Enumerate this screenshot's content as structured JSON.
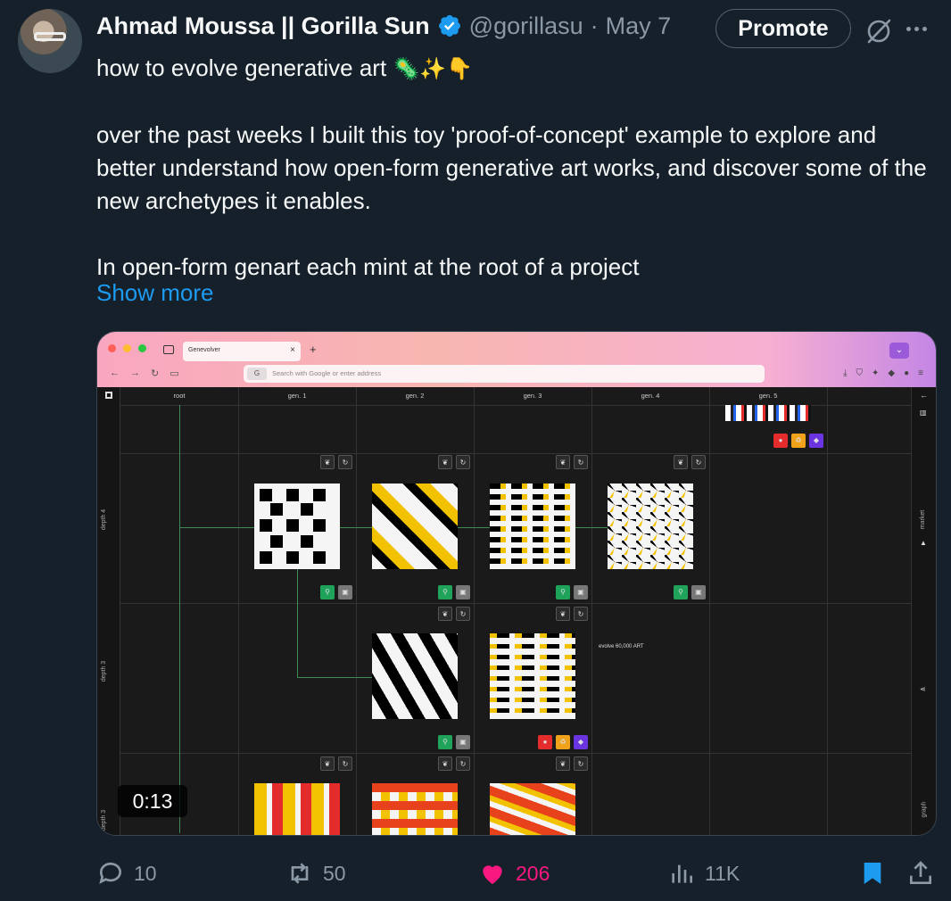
{
  "author": {
    "name": "Ahmad Moussa || Gorilla Sun",
    "handle": "@gorillasu",
    "separator": "·",
    "date": "May 7",
    "avatar_icon": "avatar-photo",
    "verified_icon": "verified-badge-icon"
  },
  "header": {
    "promote_label": "Promote",
    "grok_icon": "grok-icon",
    "more_icon": "more-icon"
  },
  "tweet": {
    "line1": "how to evolve generative art",
    "line1_emoji": "🦠✨👇",
    "para2": "over the past weeks I built this toy 'proof-of-concept' example to explore and better understand how open-form generative art works, and discover some of the new archetypes it enables.",
    "para3": "In open-form genart each mint at the root of a project",
    "show_more": "Show more"
  },
  "media": {
    "browser": {
      "tab_title": "Genevolver",
      "address_placeholder": "Search with Google or enter address",
      "google_badge": "G"
    },
    "app": {
      "columns": [
        "root",
        "gen. 1",
        "gen. 2",
        "gen. 3",
        "gen. 4",
        "gen. 5"
      ],
      "rows": [
        "depth 4",
        "depth 3",
        "depth 3"
      ],
      "right_rail": [
        "market",
        "graph"
      ],
      "evolve_label": "evolve 60,000 ART"
    },
    "video_time": "0:13",
    "colors": {
      "green": "#1fa35a",
      "yellow": "#f2c200",
      "red": "#e52c2c",
      "purple": "#6a34e0"
    }
  },
  "actions": {
    "replies": "10",
    "reposts": "50",
    "likes": "206",
    "views": "11K",
    "like_color": "#f91880",
    "bookmark_color": "#1d9bf0"
  }
}
